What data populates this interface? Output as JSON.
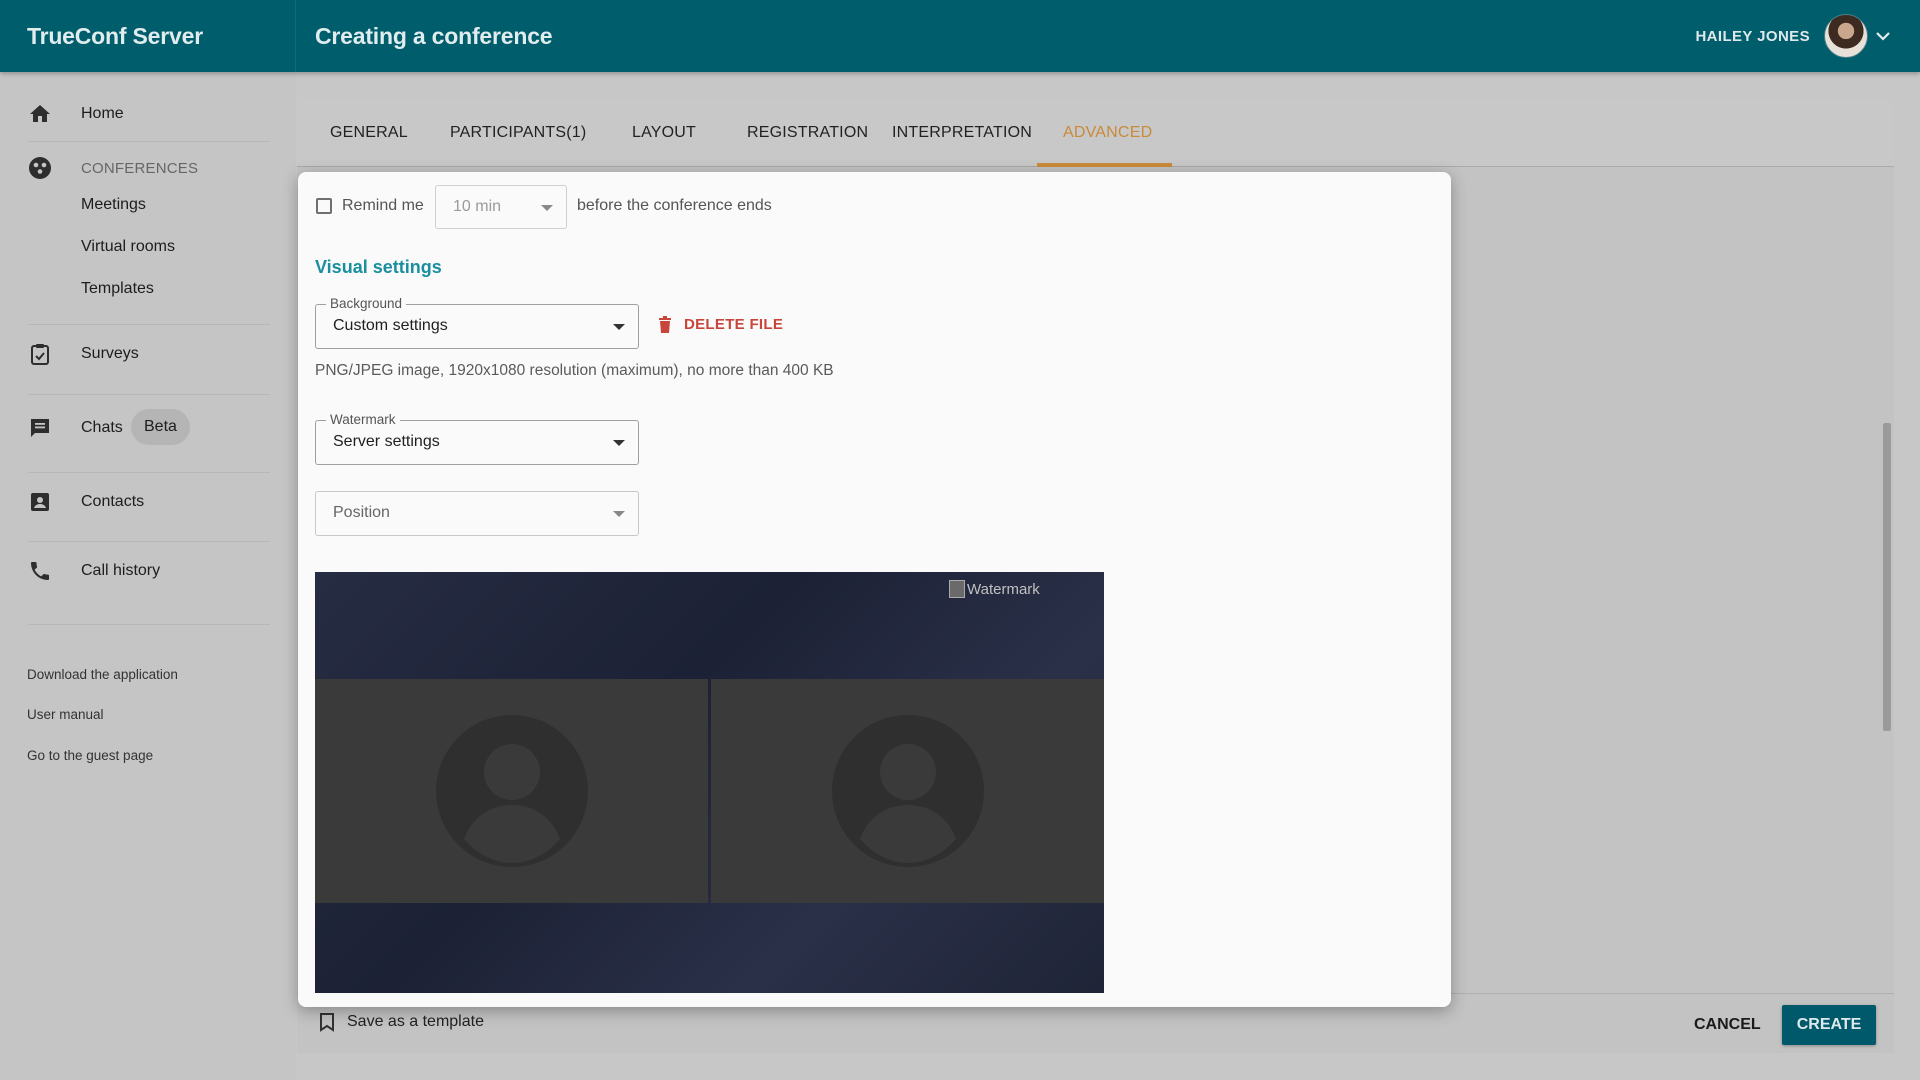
{
  "header": {
    "brand": "TrueConf Server",
    "page_title": "Creating a conference",
    "user_name": "HAILEY JONES"
  },
  "sidebar": {
    "home": "Home",
    "conferences_section": "CONFERENCES",
    "meetings": "Meetings",
    "virtual_rooms": "Virtual rooms",
    "templates": "Templates",
    "surveys": "Surveys",
    "chats": "Chats",
    "chats_badge": "Beta",
    "contacts": "Contacts",
    "call_history": "Call history",
    "links": [
      "Download the application",
      "User manual",
      "Go to the guest page"
    ]
  },
  "tabs": [
    "GENERAL",
    "PARTICIPANTS(1)",
    "LAYOUT",
    "REGISTRATION",
    "INTERPRETATION",
    "ADVANCED"
  ],
  "active_tab": "ADVANCED",
  "form": {
    "remind_label": "Remind me",
    "remind_value": "10 min",
    "remind_suffix": "before the conference ends",
    "visual_settings_title": "Visual settings",
    "background_legend": "Background",
    "background_value": "Custom settings",
    "delete_file": "DELETE FILE",
    "file_hint": "PNG/JPEG image, 1920x1080 resolution (maximum), no more than 400 KB",
    "watermark_legend": "Watermark",
    "watermark_value": "Server settings",
    "position_placeholder": "Position",
    "preview_watermark_alt": "Watermark"
  },
  "footer": {
    "save_template": "Save as a template",
    "cancel": "CANCEL",
    "create": "CREATE"
  },
  "colors": {
    "header": "#005d6b",
    "accent_tab": "#c98a3a",
    "section_title": "#1a8fa0",
    "delete": "#c8453b",
    "create_button": "#00596a"
  }
}
